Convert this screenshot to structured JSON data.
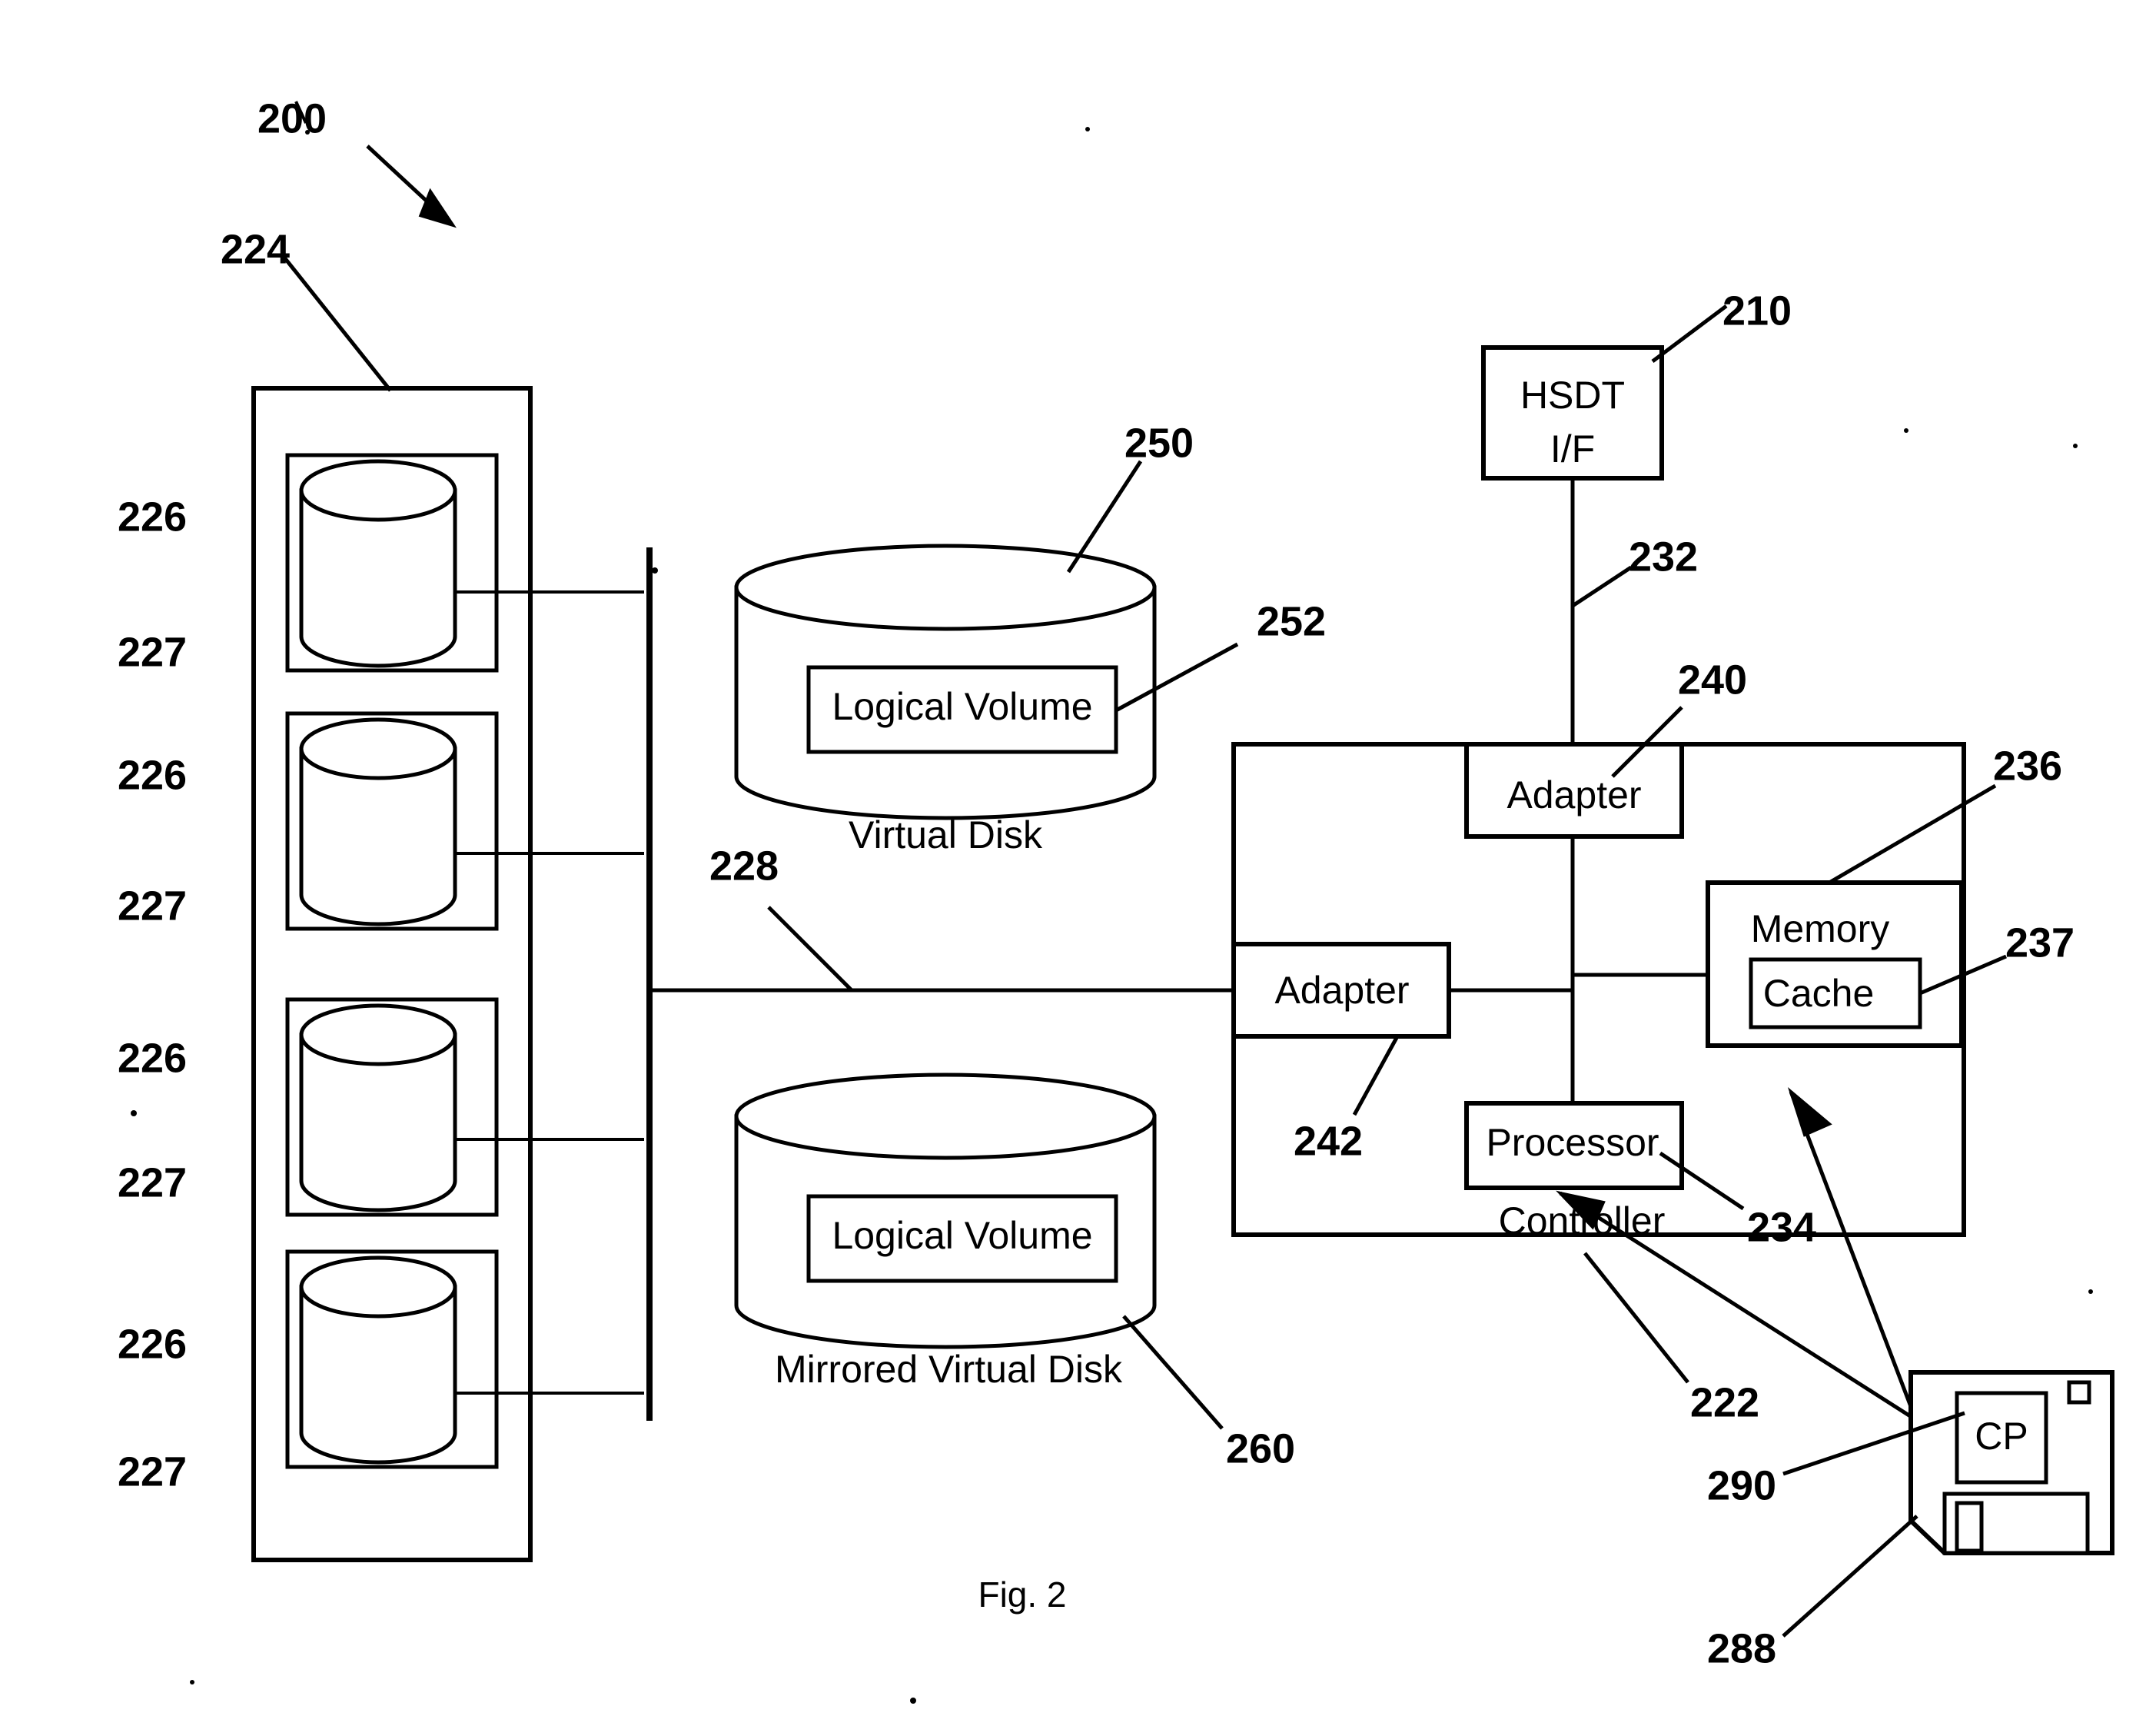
{
  "figure": {
    "caption": "Fig. 2",
    "system_ref": "200"
  },
  "disk_array": {
    "enclosure_ref": "224",
    "disks": [
      {
        "disk_ref": "226",
        "slot_ref": "227"
      },
      {
        "disk_ref": "226",
        "slot_ref": "227"
      },
      {
        "disk_ref": "226",
        "slot_ref": "227"
      },
      {
        "disk_ref": "226",
        "slot_ref": "227"
      }
    ],
    "bus_ref": "228"
  },
  "virtual_disk": {
    "label": "Virtual Disk",
    "ref": "250",
    "logical_volume_label": "Logical Volume",
    "logical_volume_ref": "252"
  },
  "mirrored_virtual_disk": {
    "label": "Mirrored Virtual Disk",
    "ref": "260",
    "logical_volume_label": "Logical Volume"
  },
  "hsdt": {
    "line1": "HSDT",
    "line2": "I/F",
    "ref": "210",
    "link_ref": "232"
  },
  "controller": {
    "label": "Controller",
    "ref": "222",
    "host_adapter_label": "Adapter",
    "host_adapter_ref": "240",
    "device_adapter_label": "Adapter",
    "device_adapter_ref": "242",
    "memory_label": "Memory",
    "memory_ref": "236",
    "cache_label": "Cache",
    "cache_ref": "237",
    "processor_label": "Processor",
    "processor_ref": "234"
  },
  "media": {
    "label": "CP",
    "program_ref": "290",
    "medium_ref": "288"
  },
  "colors": {
    "ink": "#000000",
    "paper": "#ffffff"
  }
}
